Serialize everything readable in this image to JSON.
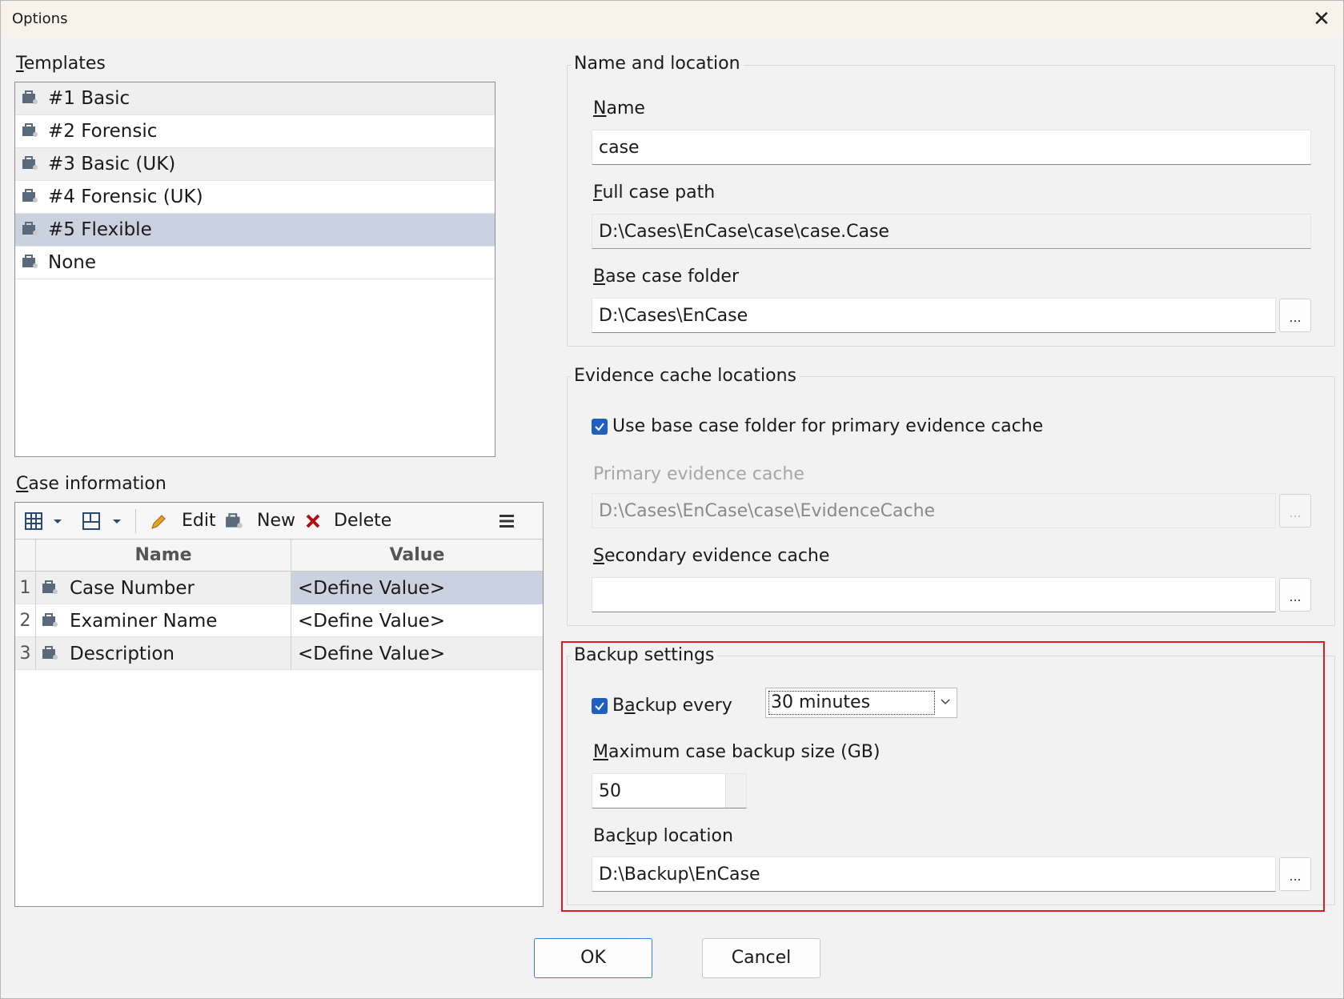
{
  "window": {
    "title": "Options",
    "close_glyph": "✕"
  },
  "templates": {
    "label": "Templates",
    "items": [
      {
        "label": "#1 Basic"
      },
      {
        "label": "#2 Forensic"
      },
      {
        "label": "#3 Basic (UK)"
      },
      {
        "label": "#4 Forensic (UK)"
      },
      {
        "label": "#5 Flexible",
        "selected": true
      },
      {
        "label": "None"
      }
    ]
  },
  "case_information": {
    "label": "Case information",
    "toolbar": {
      "edit_label": "Edit",
      "new_label": "New",
      "delete_label": "Delete"
    },
    "columns": {
      "name": "Name",
      "value": "Value"
    },
    "rows": [
      {
        "num": "1",
        "name": "Case Number",
        "value": "<Define Value>"
      },
      {
        "num": "2",
        "name": "Examiner Name",
        "value": "<Define Value>"
      },
      {
        "num": "3",
        "name": "Description",
        "value": "<Define Value>"
      }
    ]
  },
  "name_location": {
    "group_title": "Name and location",
    "name_label": "Name",
    "name_value": "case",
    "full_path_label": "Full case path",
    "full_path_value": "D:\\Cases\\EnCase\\case\\case.Case",
    "base_folder_label": "Base case folder",
    "base_folder_value": "D:\\Cases\\EnCase",
    "browse_label": "..."
  },
  "evidence_cache": {
    "group_title": "Evidence cache locations",
    "use_base_label": "Use base case folder for primary evidence cache",
    "use_base_checked": true,
    "primary_label": "Primary evidence cache",
    "primary_value": "D:\\Cases\\EnCase\\case\\EvidenceCache",
    "secondary_label": "Secondary evidence cache",
    "secondary_value": "",
    "browse_label": "..."
  },
  "backup": {
    "group_title": "Backup settings",
    "backup_every_label": "Backup every",
    "backup_every_checked": true,
    "interval_value": "30 minutes",
    "max_size_label": "Maximum case backup size (GB)",
    "max_size_value": "50",
    "location_label": "Backup location",
    "location_value": "D:\\Backup\\EnCase",
    "browse_label": "..."
  },
  "buttons": {
    "ok_label": "OK",
    "cancel_label": "Cancel"
  },
  "colors": {
    "accent": "#1f5fc2",
    "selection": "#c9d2de",
    "highlight": "#e01b24"
  }
}
